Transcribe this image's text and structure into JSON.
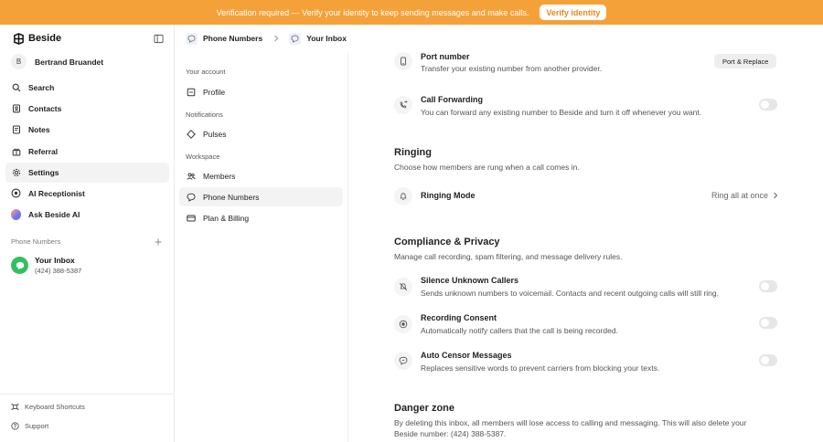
{
  "banner": {
    "text": "Verification required — Verify your identity to keep sending messages and make calls.",
    "button": "Verify identity"
  },
  "sidebar": {
    "logo": "Beside",
    "user_initial": "B",
    "user_name": "Bertrand Bruandet",
    "nav": [
      {
        "label": "Search"
      },
      {
        "label": "Contacts"
      },
      {
        "label": "Notes"
      },
      {
        "label": "Referral"
      },
      {
        "label": "Settings"
      },
      {
        "label": "AI Receptionist"
      },
      {
        "label": "Ask Beside AI"
      }
    ],
    "section_title": "Phone Numbers",
    "inbox_name": "Your Inbox",
    "inbox_number": "(424) 388-5387",
    "footer": [
      {
        "label": "Keyboard Shortcuts"
      },
      {
        "label": "Support"
      }
    ]
  },
  "breadcrumb": {
    "first": "Phone Numbers",
    "second": "Your Inbox"
  },
  "settings_nav": {
    "account_title": "Your account",
    "profile": "Profile",
    "notifications_title": "Notifications",
    "pulses": "Pulses",
    "workspace_title": "Workspace",
    "members": "Members",
    "phone_numbers": "Phone Numbers",
    "billing": "Plan & Billing"
  },
  "main": {
    "port": {
      "title": "Port number",
      "subtitle": "Transfer your existing number from another provider.",
      "button": "Port & Replace"
    },
    "forwarding": {
      "title": "Call Forwarding",
      "subtitle": "You can forward any existing number to Beside and turn it off whenever you want."
    },
    "ringing": {
      "heading": "Ringing",
      "subtitle": "Choose how members are rung when a call comes in.",
      "mode_label": "Ringing Mode",
      "mode_value": "Ring all at once"
    },
    "compliance": {
      "heading": "Compliance & Privacy",
      "subtitle": "Manage call recording, spam filtering, and message delivery rules."
    },
    "silence": {
      "title": "Silence Unknown Callers",
      "subtitle": "Sends unknown numbers to voicemail. Contacts and recent outgoing calls will still ring."
    },
    "consent": {
      "title": "Recording Consent",
      "subtitle": "Automatically notify callers that the call is being recorded."
    },
    "censor": {
      "title": "Auto Censor Messages",
      "subtitle": "Replaces sensitive words to prevent carriers from blocking your texts."
    },
    "danger": {
      "heading": "Danger zone",
      "text": "By deleting this inbox, all members will lose access to calling and messaging. This will also delete your Beside number: (424) 388-5387."
    }
  },
  "colors": {
    "banner": "#f4a13a",
    "inbox_avatar": "#33c05f"
  }
}
